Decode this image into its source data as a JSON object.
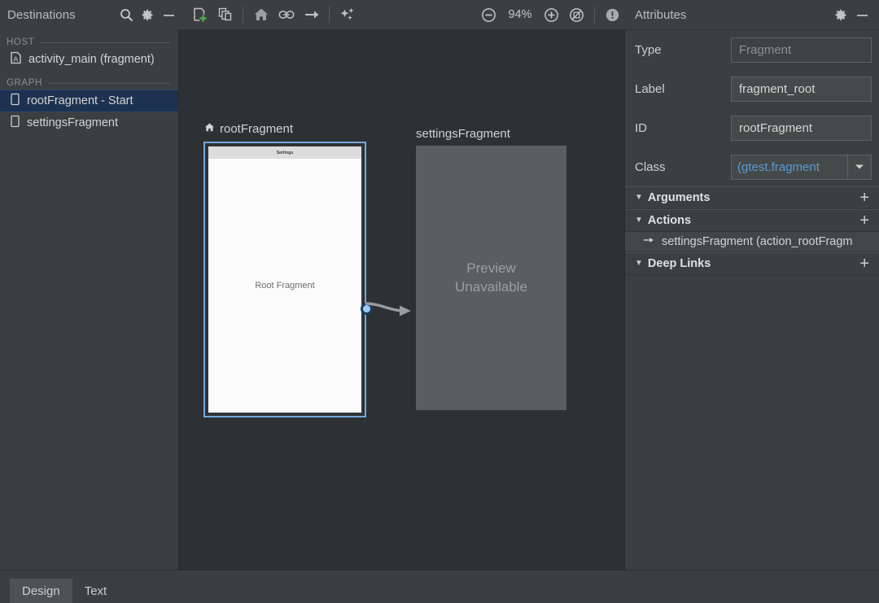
{
  "destinations_panel": {
    "title": "Destinations",
    "search_icon": "search-icon",
    "settings_icon": "gear-icon",
    "minimize_icon": "minimize-icon",
    "groups": [
      {
        "label": "HOST",
        "items": [
          {
            "label": "activity_main (fragment)",
            "icon": "activity-icon",
            "selected": false
          }
        ]
      },
      {
        "label": "GRAPH",
        "items": [
          {
            "label": "rootFragment - Start",
            "icon": "fragment-icon",
            "selected": true
          },
          {
            "label": "settingsFragment",
            "icon": "fragment-icon",
            "selected": false
          }
        ]
      }
    ]
  },
  "toolbar": {
    "new_destination": "new-destination-icon",
    "new_nested_graph": "nested-graph-icon",
    "set_start_destination": "home-icon",
    "add_deep_link": "link-icon",
    "add_action": "action-arrow-icon",
    "auto_arrange": "auto-arrange-icon",
    "zoom_out": "zoom-out-icon",
    "zoom_level": "94%",
    "zoom_in": "zoom-in-icon",
    "zoom_to_fit": "zoom-fit-icon",
    "issues": "warning-icon"
  },
  "canvas": {
    "nodes": [
      {
        "title": "rootFragment",
        "is_start": true,
        "selected": true,
        "preview_appbar_text": "Settings",
        "preview_body_text": "Root Fragment"
      },
      {
        "title": "settingsFragment",
        "is_start": false,
        "selected": false,
        "unavailable_line1": "Preview",
        "unavailable_line2": "Unavailable"
      }
    ]
  },
  "attributes_panel": {
    "title": "Attributes",
    "settings_icon": "gear-icon",
    "minimize_icon": "minimize-icon",
    "fields": [
      {
        "label": "Type",
        "value": "Fragment",
        "placeholder": true
      },
      {
        "label": "Label",
        "value": "fragment_root",
        "placeholder": false
      },
      {
        "label": "ID",
        "value": "rootFragment",
        "placeholder": false
      }
    ],
    "class_field": {
      "label": "Class",
      "value": "ɡtest.fragment)",
      "dropdown_icon": "chevron-down-icon"
    },
    "sections": [
      {
        "label": "Arguments",
        "expanded": true,
        "add_label": "+",
        "items": []
      },
      {
        "label": "Actions",
        "expanded": true,
        "add_label": "+",
        "items": [
          {
            "label": "settingsFragment (action_rootFragm",
            "icon": "action-arrow-icon"
          }
        ]
      },
      {
        "label": "Deep Links",
        "expanded": true,
        "add_label": "+",
        "items": []
      }
    ],
    "collapse_triangle": "▼"
  },
  "bottom_tabs": {
    "tabs": [
      {
        "label": "Design",
        "active": true
      },
      {
        "label": "Text",
        "active": false
      }
    ]
  },
  "colors": {
    "accent_blue": "#74a9e0",
    "selection_navy": "#1d3250",
    "link_blue": "#5b9bd5",
    "canvas_bg": "#2e3133",
    "panel_bg": "#3c3f41",
    "start_green": "#4fae56"
  }
}
